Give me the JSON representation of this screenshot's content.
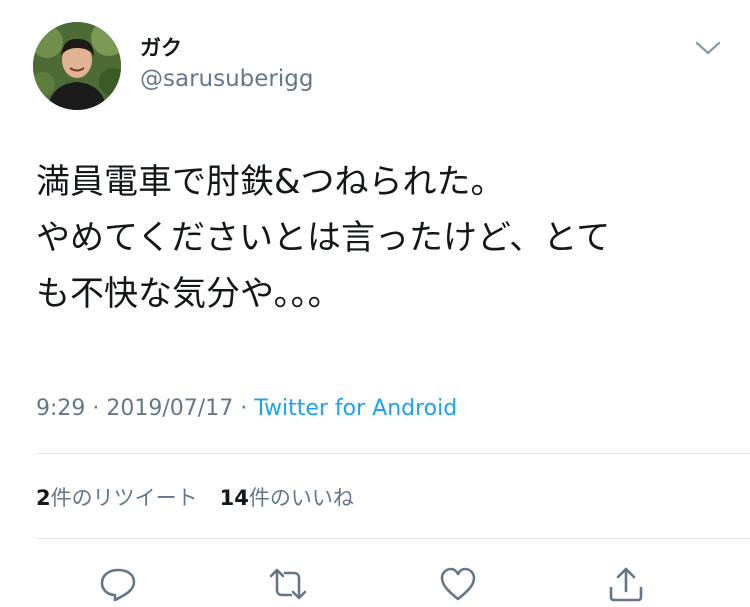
{
  "user": {
    "display_name": "ガク",
    "handle": "@sarusuberigg"
  },
  "tweet": {
    "lines": [
      "満員電車で肘鉄&つねられた。",
      "やめてくださいとは言ったけど、とて",
      "も不快な気分や。。。"
    ],
    "time": "9:29",
    "separator": " · ",
    "date": "2019/07/17",
    "source": "Twitter for Android"
  },
  "stats": {
    "retweets_count": "2",
    "retweets_label": "件のリツイート",
    "likes_count": "14",
    "likes_label": "件のいいね"
  },
  "icons": {
    "menu": "chevron-down-icon",
    "reply": "reply-icon",
    "retweet": "retweet-icon",
    "like": "heart-icon",
    "share": "share-icon"
  },
  "colors": {
    "text": "#14171a",
    "secondary": "#657786",
    "link": "#1da1f2",
    "divider": "#e1e8ed",
    "icon": "#657786"
  }
}
